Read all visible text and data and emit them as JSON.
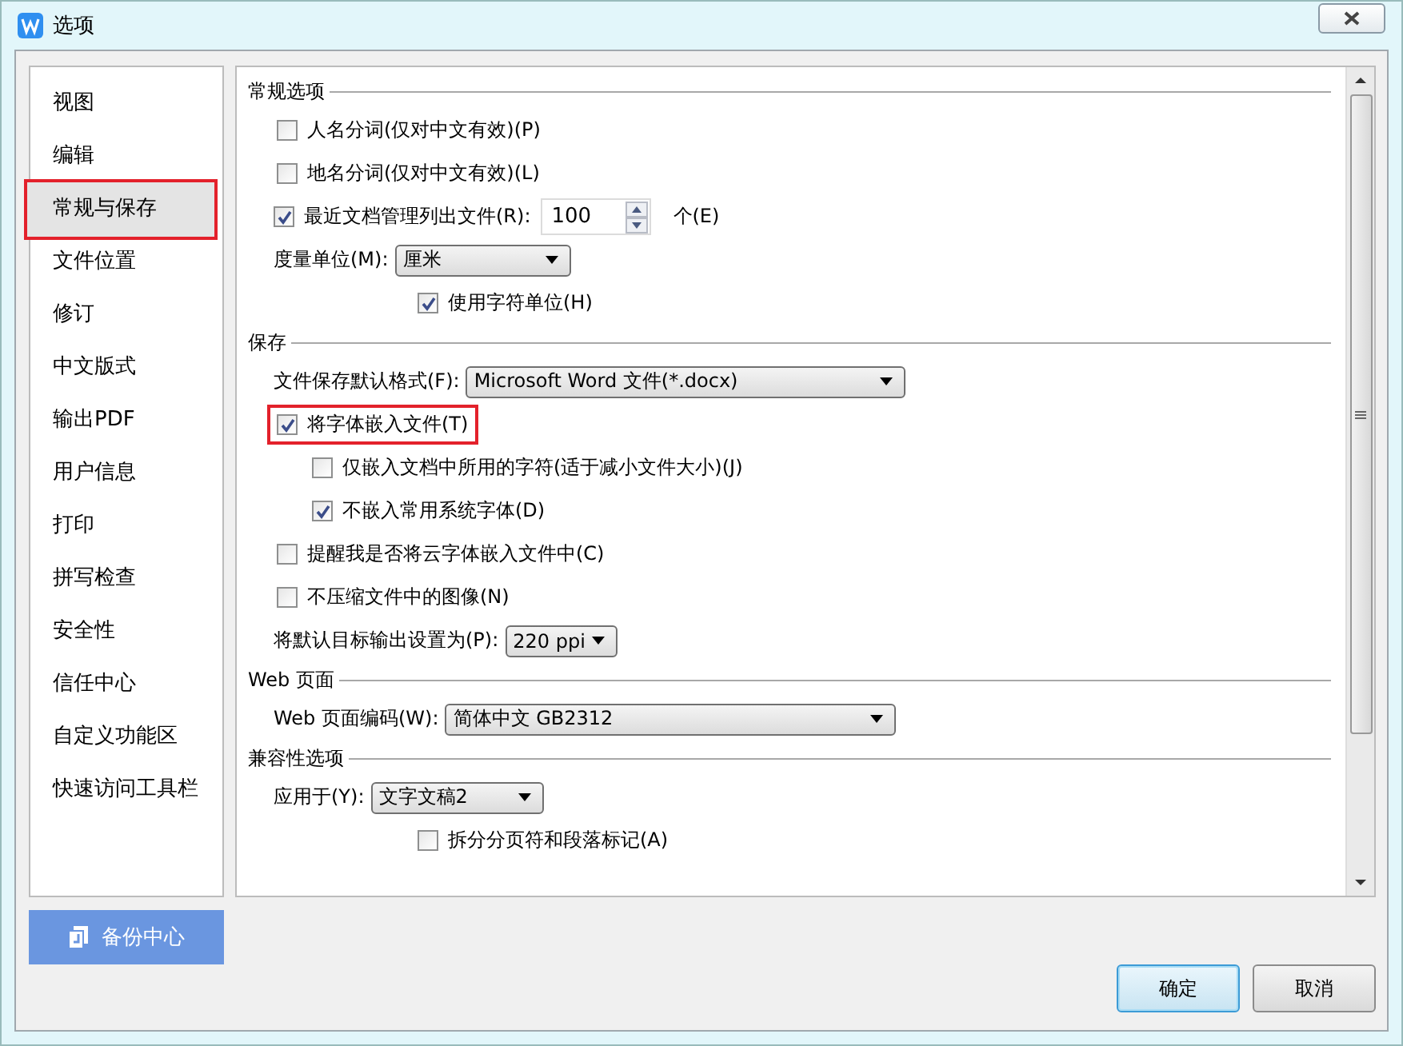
{
  "window": {
    "title": "选项"
  },
  "sidebar": {
    "items": [
      {
        "label": "视图",
        "selected": false
      },
      {
        "label": "编辑",
        "selected": false
      },
      {
        "label": "常规与保存",
        "selected": true
      },
      {
        "label": "文件位置",
        "selected": false
      },
      {
        "label": "修订",
        "selected": false
      },
      {
        "label": "中文版式",
        "selected": false
      },
      {
        "label": "输出PDF",
        "selected": false
      },
      {
        "label": "用户信息",
        "selected": false
      },
      {
        "label": "打印",
        "selected": false
      },
      {
        "label": "拼写检查",
        "selected": false
      },
      {
        "label": "安全性",
        "selected": false
      },
      {
        "label": "信任中心",
        "selected": false
      },
      {
        "label": "自定义功能区",
        "selected": false
      },
      {
        "label": "快速访问工具栏",
        "selected": false
      }
    ]
  },
  "sections": [
    {
      "title": "常规选项",
      "rows": [
        {
          "kind": "checkbox",
          "label": "人名分词(仅对中文有效)(P)",
          "checked": false
        },
        {
          "kind": "checkbox",
          "label": "地名分词(仅对中文有效)(L)",
          "checked": false
        },
        {
          "kind": "spin",
          "label": "最近文档管理列出文件(R):",
          "checked": true,
          "value": "100",
          "suffix": "个(E)"
        },
        {
          "kind": "select",
          "label": "度量单位(M):",
          "value": "厘米",
          "children": [
            {
              "kind": "checkbox",
              "label": "使用字符单位(H)",
              "checked": true
            }
          ]
        }
      ]
    },
    {
      "title": "保存",
      "rows": [
        {
          "kind": "select",
          "label": "文件保存默认格式(F):",
          "value": "Microsoft Word 文件(*.docx)"
        },
        {
          "kind": "checkbox",
          "label": "将字体嵌入文件(T)",
          "checked": true,
          "highlighted": true,
          "children": [
            {
              "kind": "checkbox",
              "label": "仅嵌入文档中所用的字符(适于减小文件大小)(J)",
              "checked": false
            },
            {
              "kind": "checkbox",
              "label": "不嵌入常用系统字体(D)",
              "checked": true
            }
          ]
        },
        {
          "kind": "checkbox",
          "label": "提醒我是否将云字体嵌入文件中(C)",
          "checked": false
        },
        {
          "kind": "checkbox",
          "label": "不压缩文件中的图像(N)",
          "checked": false
        },
        {
          "kind": "select",
          "label": "将默认目标输出设置为(P):",
          "value": "220 ppi"
        }
      ]
    },
    {
      "title": "Web 页面",
      "rows": [
        {
          "kind": "select",
          "label": "Web 页面编码(W):",
          "value": "简体中文 GB2312"
        }
      ]
    },
    {
      "title": "兼容性选项",
      "rows": [
        {
          "kind": "select",
          "label": "应用于(Y):",
          "value": "文字文稿2",
          "children": [
            {
              "kind": "checkbox",
              "label": "拆分分页符和段落标记(A)",
              "checked": false
            }
          ]
        }
      ]
    }
  ],
  "backup_button": "备份中心",
  "buttons": [
    "确定",
    "取消"
  ]
}
